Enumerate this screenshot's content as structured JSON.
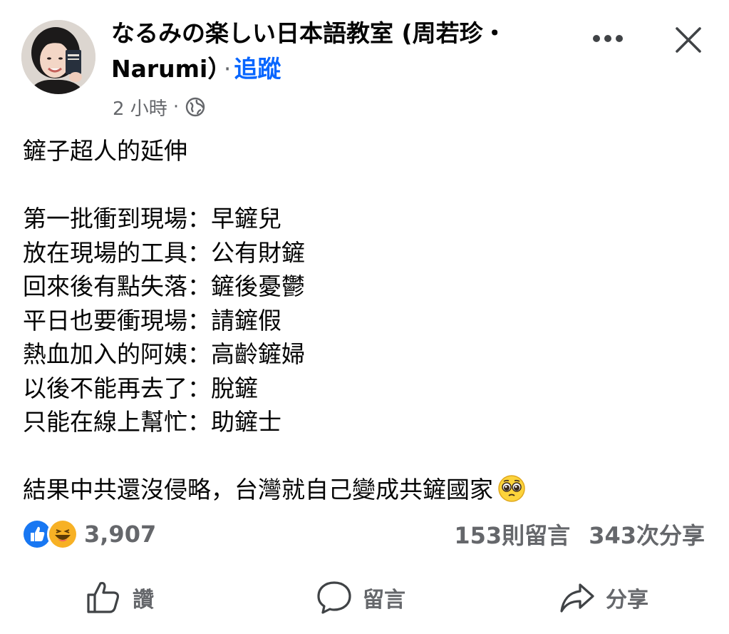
{
  "post": {
    "author_name": "なるみの楽しい日本語教室 (周若珍・Narumi）",
    "follow_label": "追蹤",
    "separator": "·",
    "timestamp": "2 小時",
    "audience_icon": "globe-icon",
    "more_icon": "more-horizontal-icon",
    "close_icon": "close-icon",
    "body": {
      "title": "鏟子超人的延伸",
      "lines": [
        "第一批衝到現場：早鏟兒",
        "放在現場的工具：公有財鏟",
        "回來後有點失落：鏟後憂鬱",
        "平日也要衝現場：請鏟假",
        "熱血加入的阿姨：高齡鏟婦",
        "以後不能再去了：脫鏟",
        "只能在線上幫忙：助鏟士"
      ],
      "closing": "結果中共還沒侵略，台灣就自己變成共鏟國家",
      "closing_emoji": "pleading-face-emoji"
    },
    "reactions": {
      "icons": [
        "like-reaction-icon",
        "haha-reaction-icon"
      ],
      "count": "3,907"
    },
    "comments_count": "153則留言",
    "shares_count": "343次分享",
    "actions": {
      "like_label": "讚",
      "comment_label": "留言",
      "share_label": "分享"
    },
    "colors": {
      "follow_blue": "#0866ff",
      "secondary_text": "#65676b",
      "like_blue": "#1877f2",
      "haha_yellow": "#f7b125"
    }
  }
}
